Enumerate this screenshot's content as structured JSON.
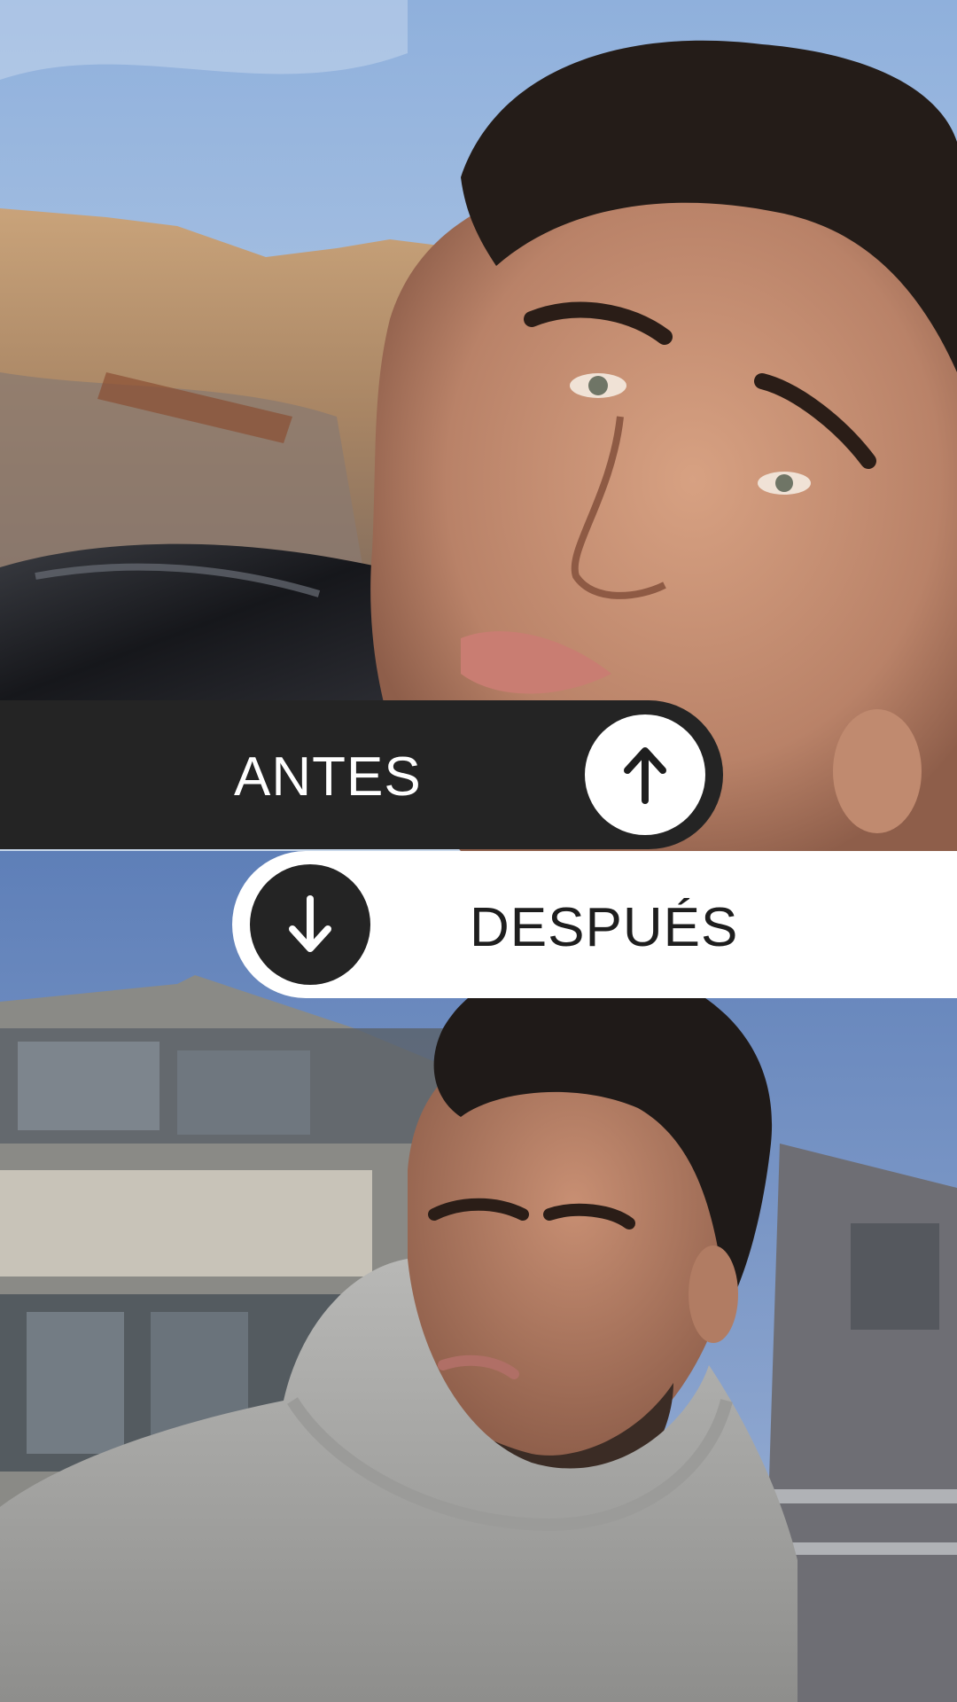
{
  "before": {
    "label": "ANTES",
    "arrow_icon": "arrow-up-icon",
    "photo": "photo-before"
  },
  "after": {
    "label": "DESPUÉS",
    "arrow_icon": "arrow-down-icon",
    "photo": "photo-after"
  },
  "colors": {
    "band_dark": "#242424",
    "band_light": "#ffffff",
    "text_light": "#ffffff",
    "text_dark": "#1e1e1e"
  }
}
